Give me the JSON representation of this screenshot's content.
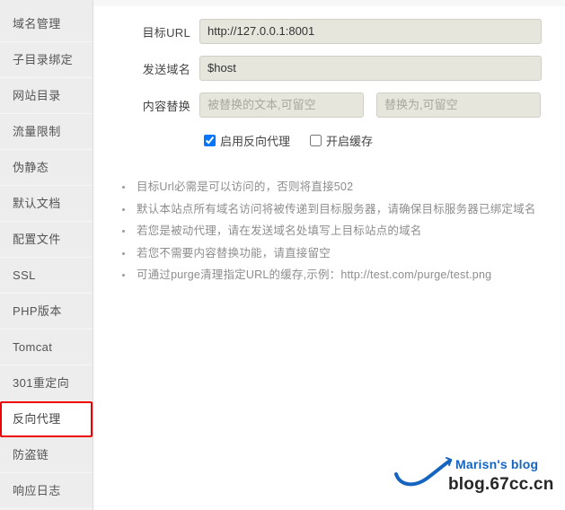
{
  "sidebar": {
    "items": [
      {
        "label": "域名管理",
        "active": false
      },
      {
        "label": "子目录绑定",
        "active": false
      },
      {
        "label": "网站目录",
        "active": false
      },
      {
        "label": "流量限制",
        "active": false
      },
      {
        "label": "伪静态",
        "active": false
      },
      {
        "label": "默认文档",
        "active": false
      },
      {
        "label": "配置文件",
        "active": false
      },
      {
        "label": "SSL",
        "active": false
      },
      {
        "label": "PHP版本",
        "active": false
      },
      {
        "label": "Tomcat",
        "active": false
      },
      {
        "label": "301重定向",
        "active": false
      },
      {
        "label": "反向代理",
        "active": true
      },
      {
        "label": "防盗链",
        "active": false
      },
      {
        "label": "响应日志",
        "active": false
      }
    ],
    "active_highlight_color": "#ee0000",
    "background_color": "#ededed"
  },
  "form": {
    "rows": [
      {
        "label": "目标URL",
        "value": "http://127.0.0.1:8001",
        "placeholder": ""
      },
      {
        "label": "发送域名",
        "value": "$host",
        "placeholder": ""
      }
    ],
    "replace_row": {
      "label": "内容替换",
      "left_value": "",
      "left_placeholder": "被替换的文本,可留空",
      "right_value": "",
      "right_placeholder": "替换为,可留空"
    },
    "checkboxes": [
      {
        "label": "启用反向代理",
        "checked": true
      },
      {
        "label": "开启缓存",
        "checked": false
      }
    ],
    "field_background": "#e6e6dd"
  },
  "notes": [
    "目标Url必需是可以访问的，否则将直接502",
    "默认本站点所有域名访问将被传递到目标服务器，请确保目标服务器已绑定域名",
    "若您是被动代理，请在发送域名处填写上目标站点的域名",
    "若您不需要内容替换功能，请直接留空",
    "可通过purge清理指定URL的缓存,示例：http://test.com/purge/test.png"
  ],
  "watermark": {
    "title": "Marisn's blog",
    "domain": "blog.67cc.cn",
    "title_color": "#1565c0",
    "domain_color": "#262626",
    "swoosh_color": "#1565c0"
  }
}
